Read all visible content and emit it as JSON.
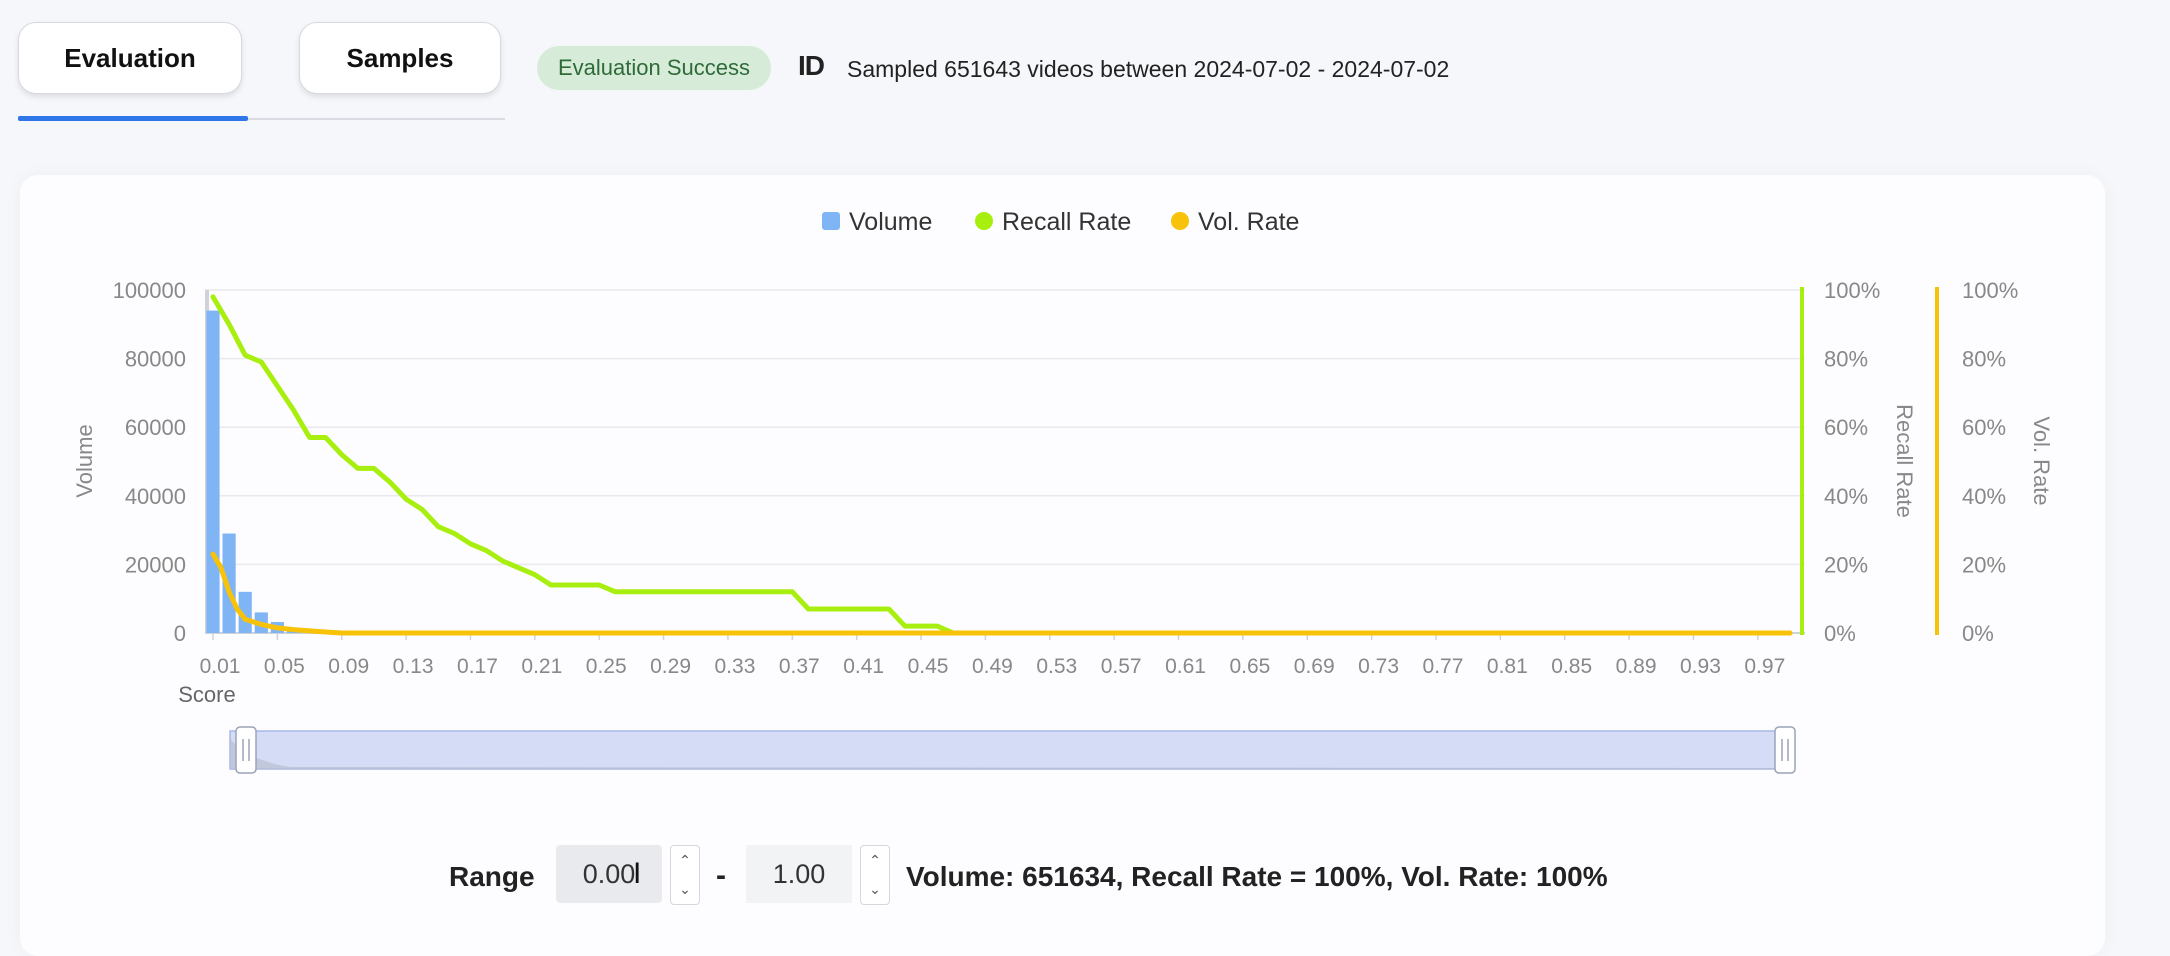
{
  "tabs": [
    {
      "label": "Evaluation",
      "active": true
    },
    {
      "label": "Samples",
      "active": false
    }
  ],
  "status_badge": "Evaluation Success",
  "id_mark": "ID",
  "sampled_text": "Sampled 651643 videos between 2024-07-02 - 2024-07-02",
  "colors": {
    "volume": "#7fb5f5",
    "recall": "#a8ef10",
    "volrate": "#f7c207",
    "accent": "#2f76e8",
    "badge_bg": "#d6ecd8"
  },
  "chart_data": {
    "type": "bar",
    "legend": [
      "Volume",
      "Recall Rate",
      "Vol. Rate"
    ],
    "legend_position": "top-center",
    "xlabel": "Score",
    "ylabel_left": "Volume",
    "ylabel_right1": "Recall Rate",
    "ylabel_right2": "Vol. Rate",
    "y_left_ticks": [
      "0",
      "20000",
      "40000",
      "60000",
      "80000",
      "100000"
    ],
    "y_left_range": [
      0,
      100000
    ],
    "y_right_ticks": [
      "0%",
      "20%",
      "40%",
      "60%",
      "80%",
      "100%"
    ],
    "y_right_range": [
      0,
      100
    ],
    "x_range": [
      0.01,
      0.99
    ],
    "x_tick_labels": [
      "0.01",
      "0.05",
      "0.09",
      "0.13",
      "0.17",
      "0.21",
      "0.25",
      "0.29",
      "0.33",
      "0.37",
      "0.41",
      "0.45",
      "0.49",
      "0.53",
      "0.57",
      "0.61",
      "0.65",
      "0.69",
      "0.73",
      "0.77",
      "0.81",
      "0.85",
      "0.89",
      "0.93",
      "0.97"
    ],
    "grid": true,
    "bars": {
      "name": "Volume",
      "x": [
        0.01,
        0.02,
        0.03,
        0.04,
        0.05,
        0.06,
        0.07,
        0.08
      ],
      "values": [
        94000,
        29000,
        12000,
        6000,
        3200,
        1500,
        800,
        400
      ]
    },
    "series": [
      {
        "name": "Recall Rate",
        "x": [
          0.01,
          0.02,
          0.03,
          0.04,
          0.05,
          0.06,
          0.07,
          0.08,
          0.09,
          0.1,
          0.11,
          0.12,
          0.13,
          0.14,
          0.15,
          0.16,
          0.17,
          0.18,
          0.19,
          0.2,
          0.21,
          0.22,
          0.25,
          0.26,
          0.37,
          0.38,
          0.43,
          0.44,
          0.46,
          0.47,
          0.99
        ],
        "values": [
          98,
          90,
          81,
          79,
          72,
          65,
          57,
          57,
          52,
          48,
          48,
          44,
          39,
          36,
          31,
          29,
          26,
          24,
          21,
          19,
          17,
          14,
          14,
          12,
          12,
          7,
          7,
          2,
          2,
          0,
          0
        ]
      },
      {
        "name": "Vol. Rate",
        "x": [
          0.01,
          0.015,
          0.02,
          0.025,
          0.03,
          0.04,
          0.05,
          0.06,
          0.07,
          0.08,
          0.09,
          0.99
        ],
        "values": [
          23,
          19,
          12,
          7,
          4,
          2.5,
          1.5,
          1,
          0.6,
          0.3,
          0,
          0
        ]
      }
    ]
  },
  "range": {
    "label": "Range",
    "min": "0.00",
    "max": "1.00",
    "separator": "-",
    "stepper_up": "⌃",
    "stepper_down": "⌄",
    "summary": "Volume: 651634, Recall Rate = 100%, Vol. Rate: 100%"
  }
}
